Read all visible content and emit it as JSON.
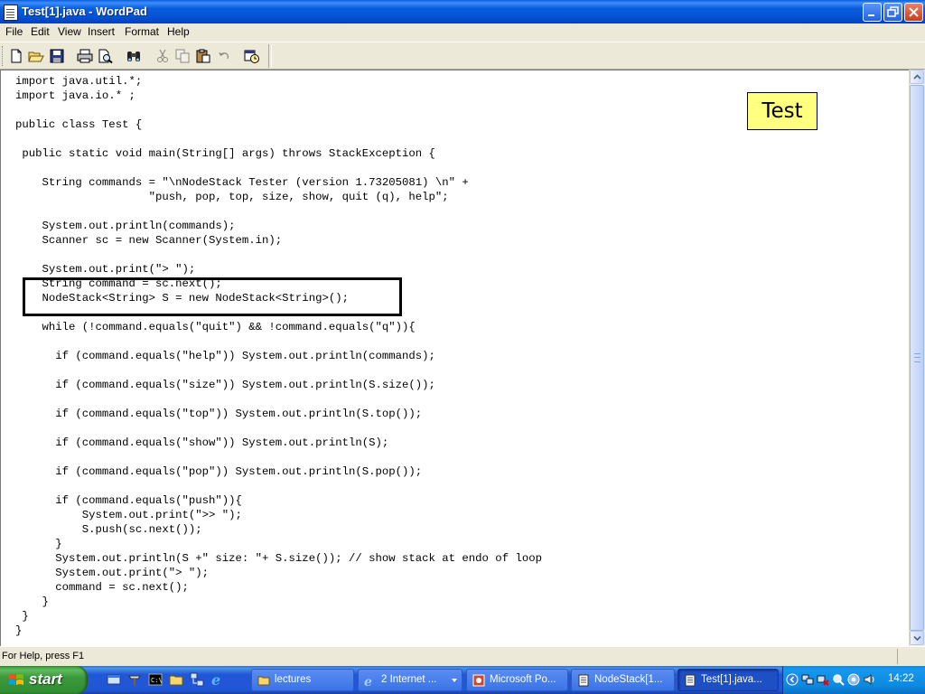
{
  "window": {
    "title": "Test[1].java - WordPad"
  },
  "menu": [
    "File",
    "Edit",
    "View",
    "Insert",
    "Format",
    "Help"
  ],
  "toolbar": {
    "tools": [
      "new",
      "open",
      "save",
      "print",
      "print-preview",
      "find",
      "cut",
      "copy",
      "paste",
      "undo",
      "date-time"
    ]
  },
  "document": {
    "lines": [
      "import java.util.*;",
      "import java.io.* ;",
      "",
      "public class Test {",
      "",
      " public static void main(String[] args) throws StackException {",
      "",
      "    String commands = \"\\nNodeStack Tester (version 1.73205081) \\n\" +",
      "                    \"push, pop, top, size, show, quit (q), help\";",
      "",
      "    System.out.println(commands);",
      "    Scanner sc = new Scanner(System.in);",
      "",
      "    System.out.print(\"> \");",
      "    String command = sc.next();",
      "    NodeStack<String> S = new NodeStack<String>();",
      "",
      "    while (!command.equals(\"quit\") && !command.equals(\"q\")){",
      "",
      "      if (command.equals(\"help\")) System.out.println(commands);",
      "",
      "      if (command.equals(\"size\")) System.out.println(S.size());",
      "",
      "      if (command.equals(\"top\")) System.out.println(S.top());",
      "",
      "      if (command.equals(\"show\")) System.out.println(S);",
      "",
      "      if (command.equals(\"pop\")) System.out.println(S.pop());",
      "",
      "      if (command.equals(\"push\")){",
      "          System.out.print(\">> \");",
      "          S.push(sc.next());",
      "      }",
      "      System.out.println(S +\" size: \"+ S.size()); // show stack at endo of loop",
      "      System.out.print(\"> \");",
      "      command = sc.next();",
      "    }",
      " }",
      "}"
    ],
    "note_label": "Test"
  },
  "status": {
    "text": "For Help, press F1"
  },
  "taskbar": {
    "start_label": "start",
    "tasks": [
      {
        "label": "lectures",
        "icon": "folder-icon"
      },
      {
        "label": "2 Internet ...",
        "icon": "internet-explorer-icon"
      },
      {
        "label": "Microsoft Po...",
        "icon": "powerpoint-icon"
      },
      {
        "label": "NodeStack[1...",
        "icon": "wordpad-icon"
      },
      {
        "label": "Test[1].java...",
        "icon": "wordpad-icon"
      }
    ],
    "clock": "14:22"
  },
  "colors": {
    "note_background": "#ffff80",
    "titlebar_blue": "#0a5fdd",
    "start_green": "#3c9a3c"
  }
}
